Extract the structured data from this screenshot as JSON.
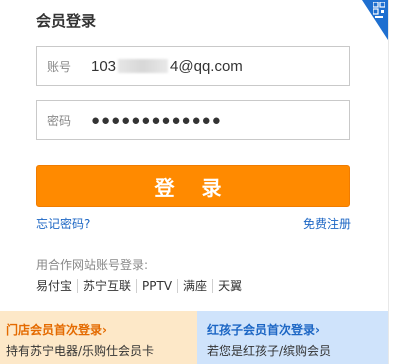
{
  "title": "会员登录",
  "account": {
    "label": "账号",
    "value_prefix": "103",
    "value_suffix": "4@qq.com"
  },
  "password": {
    "label": "密码",
    "masked": "●●●●●●●●●●●●●"
  },
  "login_button": "登 录",
  "forgot_link": "忘记密码?",
  "register_link": "免费注册",
  "partner_label": "用合作网站账号登录:",
  "partners": [
    "易付宝",
    "苏宁互联",
    "PPTV",
    "满座",
    "天翼"
  ],
  "promo_store": {
    "title": "门店会员首次登录›",
    "subtitle": "持有苏宁电器/乐购仕会员卡"
  },
  "promo_kids": {
    "title": "红孩子会员首次登录›",
    "subtitle": "若您是红孩子/缤购会员"
  },
  "colors": {
    "accent": "#ff8a00",
    "link": "#1c66c4",
    "qr": "#1e6fd0"
  },
  "icons": {
    "qr": "qr-code-icon"
  }
}
